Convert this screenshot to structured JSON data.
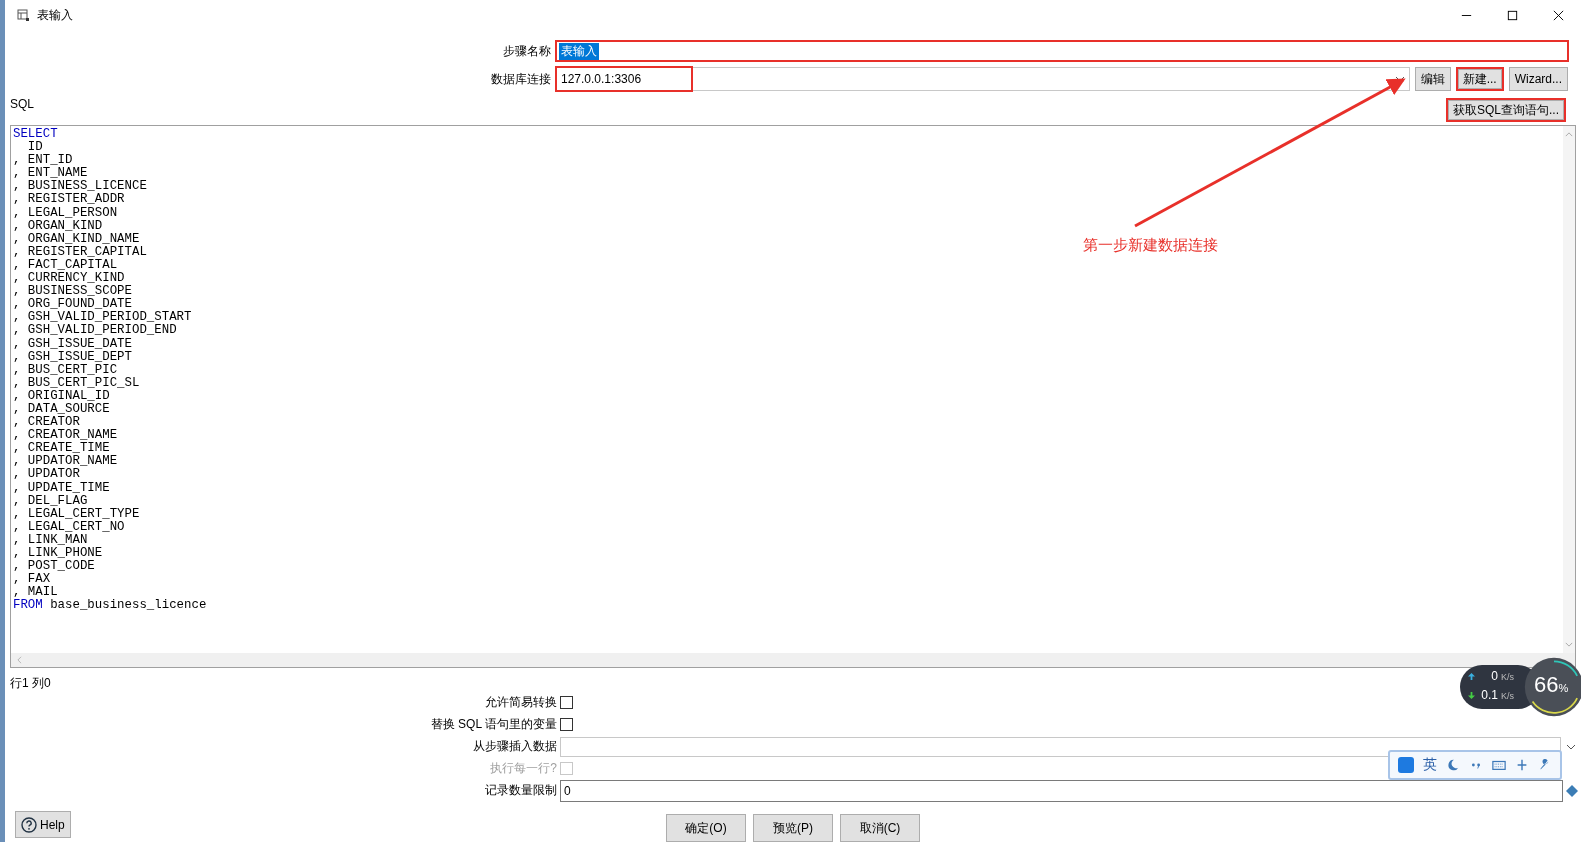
{
  "window": {
    "title": "表输入"
  },
  "step_name": {
    "label": "步骤名称",
    "value": "表输入",
    "value_selected": true,
    "highlighted": true
  },
  "db_connection": {
    "label": "数据库连接",
    "value": "127.0.0.1:3306",
    "highlighted": true,
    "buttons": [
      {
        "label": "编辑",
        "highlighted": false
      },
      {
        "label": "新建...",
        "highlighted": true
      },
      {
        "label": "Wizard...",
        "highlighted": false
      }
    ]
  },
  "sql": {
    "label": "SQL",
    "get_sql_button": {
      "label": "获取SQL查询语句...",
      "highlighted": true
    },
    "lines": [
      {
        "keyword": "SELECT"
      },
      {
        "text": "  ID"
      },
      {
        "text": ", ENT_ID"
      },
      {
        "text": ", ENT_NAME"
      },
      {
        "text": ", BUSINESS_LICENCE"
      },
      {
        "text": ", REGISTER_ADDR"
      },
      {
        "text": ", LEGAL_PERSON"
      },
      {
        "text": ", ORGAN_KIND"
      },
      {
        "text": ", ORGAN_KIND_NAME"
      },
      {
        "text": ", REGISTER_CAPITAL"
      },
      {
        "text": ", FACT_CAPITAL"
      },
      {
        "text": ", CURRENCY_KIND"
      },
      {
        "text": ", BUSINESS_SCOPE"
      },
      {
        "text": ", ORG_FOUND_DATE"
      },
      {
        "text": ", GSH_VALID_PERIOD_START"
      },
      {
        "text": ", GSH_VALID_PERIOD_END"
      },
      {
        "text": ", GSH_ISSUE_DATE"
      },
      {
        "text": ", GSH_ISSUE_DEPT"
      },
      {
        "text": ", BUS_CERT_PIC"
      },
      {
        "text": ", BUS_CERT_PIC_SL"
      },
      {
        "text": ", ORIGINAL_ID"
      },
      {
        "text": ", DATA_SOURCE"
      },
      {
        "text": ", CREATOR"
      },
      {
        "text": ", CREATOR_NAME"
      },
      {
        "text": ", CREATE_TIME"
      },
      {
        "text": ", UPDATOR_NAME"
      },
      {
        "text": ", UPDATOR"
      },
      {
        "text": ", UPDATE_TIME"
      },
      {
        "text": ", DEL_FLAG"
      },
      {
        "text": ", LEGAL_CERT_TYPE"
      },
      {
        "text": ", LEGAL_CERT_NO"
      },
      {
        "text": ", LINK_MAN"
      },
      {
        "text": ", LINK_PHONE"
      },
      {
        "text": ", POST_CODE"
      },
      {
        "text": ", FAX"
      },
      {
        "text": ", MAIL"
      },
      {
        "keyword": "FROM",
        "text": " base_business_licence"
      }
    ],
    "cursor_position": "行1 列0"
  },
  "options": [
    {
      "kind": "checkbox",
      "label": "允许简易转换",
      "checked": false,
      "disabled": false
    },
    {
      "kind": "checkbox",
      "label": "替换 SQL 语句里的变量",
      "checked": false,
      "disabled": false
    },
    {
      "kind": "dropdown",
      "label": "从步骤插入数据"
    },
    {
      "kind": "checkbox",
      "label": "执行每一行?",
      "checked": false,
      "disabled": true
    },
    {
      "kind": "text",
      "label": "记录数量限制",
      "value": "0"
    }
  ],
  "help_button": {
    "label": "Help"
  },
  "footer_buttons": [
    {
      "label": "确定(O)"
    },
    {
      "label": "预览(P)"
    },
    {
      "label": "取消(C)"
    }
  ],
  "annotation": {
    "text": "第一步新建数据连接"
  },
  "network_widget": {
    "upload": "0",
    "upload_unit": "K/s",
    "download": "0.1",
    "download_unit": "K/s",
    "percent": "66",
    "percent_sign": "%"
  },
  "ime_toolbar": {
    "language": "英"
  }
}
